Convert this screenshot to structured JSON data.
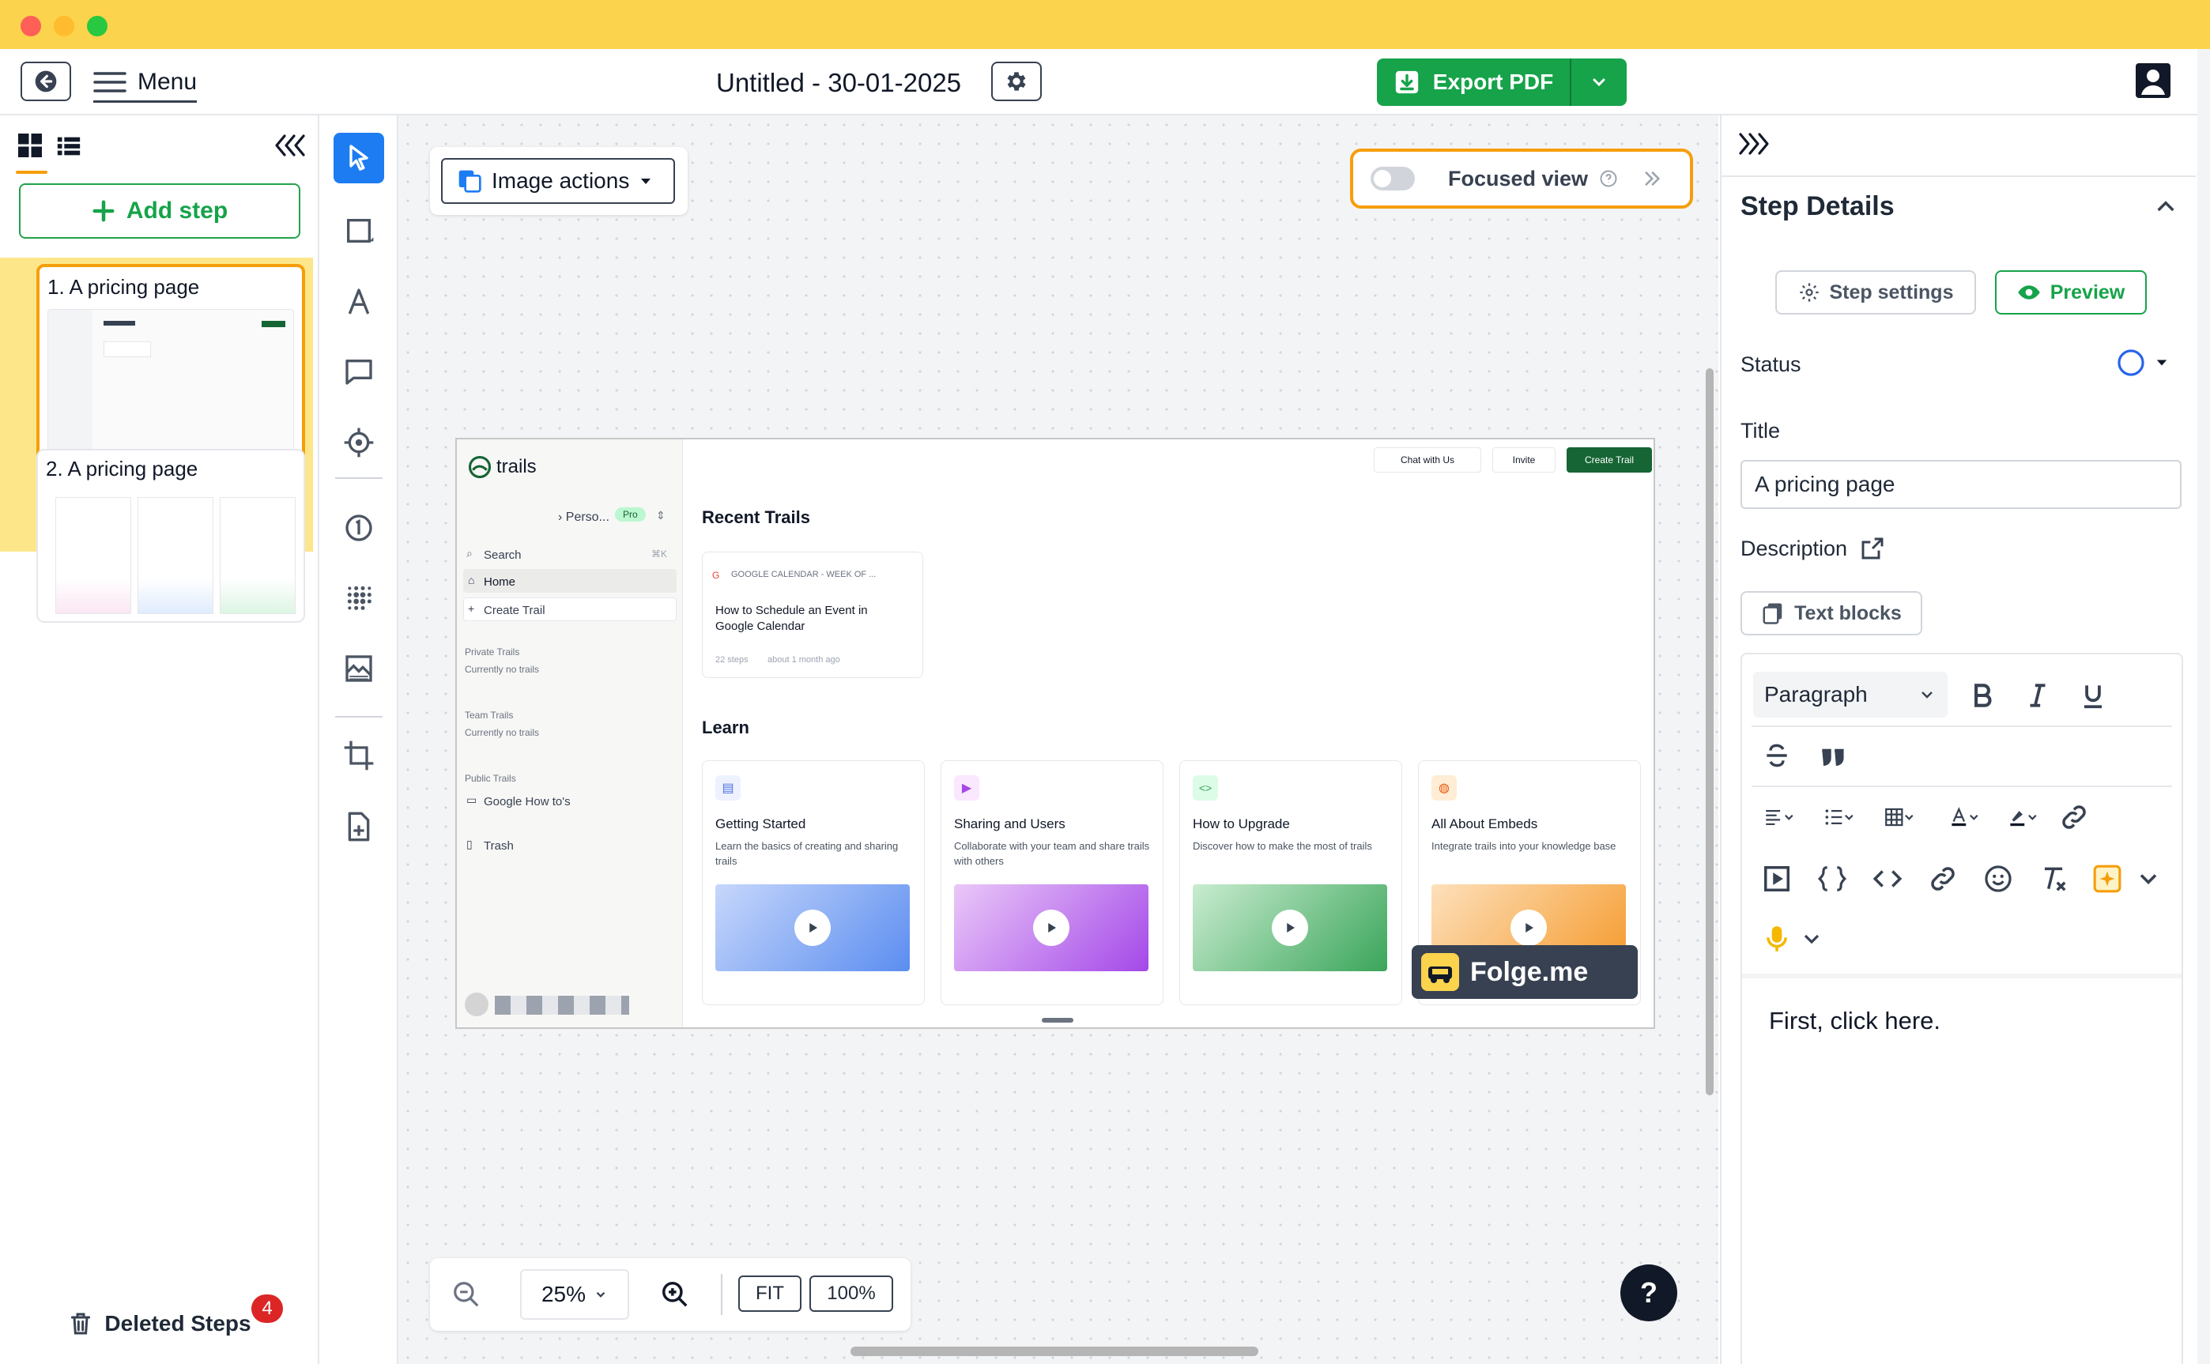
{
  "app": {
    "document_title": "Untitled - 30-01-2025",
    "menu_label": "Menu",
    "export_label": "Export PDF",
    "colors": {
      "titlebar": "#fbd34d",
      "accent_green": "#16a34a",
      "focus_orange": "#f59e0b"
    }
  },
  "sidebar": {
    "add_step_label": "Add step",
    "steps": [
      {
        "title": "1. A pricing page",
        "selected": true
      },
      {
        "title": "2. A pricing page",
        "selected": false
      }
    ],
    "deleted_label": "Deleted Steps",
    "deleted_count": "4"
  },
  "canvas": {
    "image_actions_label": "Image actions",
    "focused_view_label": "Focused view",
    "zoom_value": "25%",
    "fit_label": "FIT",
    "hundred_label": "100%",
    "help_label": "?",
    "watermark_label": "Folge.me"
  },
  "screenshot": {
    "logo": "trails",
    "workspace": "› Perso...",
    "pro_badge": "Pro",
    "search": "Search",
    "search_shortcut": "⌘K",
    "home": "Home",
    "create_trail": "Create Trail",
    "private_trails": "Private Trails",
    "private_empty": "Currently no trails",
    "team_trails": "Team Trails",
    "team_empty": "Currently no trails",
    "public_trails": "Public Trails",
    "public_item": "Google How to's",
    "trash": "Trash",
    "chat_btn": "Chat with Us",
    "invite_btn": "Invite",
    "create_btn": "Create Trail",
    "recent_heading": "Recent Trails",
    "recent_card": {
      "source": "GOOGLE CALENDAR - WEEK OF ...",
      "title": "How to Schedule an Event in Google Calendar",
      "steps": "22 steps",
      "age": "about 1 month ago"
    },
    "learn_heading": "Learn",
    "learn_cards": [
      {
        "title": "Getting Started",
        "desc": "Learn the basics of creating and sharing trails",
        "icon": "book-icon",
        "from": "#c7d7fb",
        "to": "#5b8df0"
      },
      {
        "title": "Sharing and Users",
        "desc": "Collaborate with your team and share trails with others",
        "icon": "video-icon",
        "from": "#eac8f8",
        "to": "#a448e8"
      },
      {
        "title": "How to Upgrade",
        "desc": "Discover how to make the most of trails",
        "icon": "code-icon",
        "from": "#c9ecd0",
        "to": "#3aa55a"
      },
      {
        "title": "All About Embeds",
        "desc": "Integrate trails into your knowledge base",
        "icon": "globe-icon",
        "from": "#fde0bb",
        "to": "#f59a2c"
      }
    ]
  },
  "right_panel": {
    "heading": "Step Details",
    "step_settings_label": "Step settings",
    "preview_label": "Preview",
    "status_label": "Status",
    "title_label": "Title",
    "title_value": "A pricing page",
    "description_label": "Description",
    "text_blocks_label": "Text blocks",
    "paragraph_label": "Paragraph",
    "editor_text": "First, click here."
  }
}
